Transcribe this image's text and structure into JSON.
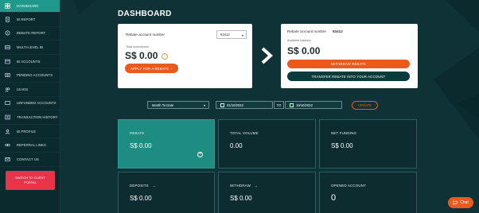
{
  "sidebar": {
    "items": [
      {
        "label": "DASHBOARD",
        "icon": "dashboard-icon",
        "active": true
      },
      {
        "label": "IB REPORT",
        "icon": "report-icon"
      },
      {
        "label": "REBATE REPORT",
        "icon": "rebate-icon"
      },
      {
        "label": "MULTI-LEVEL IB",
        "icon": "network-icon"
      },
      {
        "label": "IB ACCOUNTS",
        "icon": "accounts-icon"
      },
      {
        "label": "PENDING ACCOUNTS",
        "icon": "pending-icon"
      },
      {
        "label": "LEADS",
        "icon": "leads-icon"
      },
      {
        "label": "UNFUNDED ACCOUNTS",
        "icon": "unfunded-icon"
      },
      {
        "label": "TRANSACTION HISTORY",
        "icon": "history-icon"
      },
      {
        "label": "IB PROFILE",
        "icon": "profile-icon"
      },
      {
        "label": "REFERRAL LINKS",
        "icon": "link-icon"
      },
      {
        "label": "CONTACT US",
        "icon": "contact-icon"
      }
    ],
    "switch_line1": "SWITCH TO CLIENT",
    "switch_line2": "PORTAL"
  },
  "page_title": "DASHBOARD",
  "rebate_card": {
    "account_label": "Rebate account number",
    "account_select": "63412",
    "commission_label": "Total commission",
    "commission_value": "S$ 0.00",
    "apply_button": "APPLY FOR A REBATE",
    "apply_arrow": "›"
  },
  "balance_card": {
    "account_label": "Rebate account number",
    "account_number": "63412",
    "balance_label": "Available balance",
    "balance_value": "S$ 0.00",
    "withdraw_button": "WITHDRAW REBATE",
    "transfer_button": "TRANSFER REBATE INTO YOUR ACCOUNT"
  },
  "filters": {
    "period": "Month To Date",
    "date_from": "01/10/2022",
    "to_label": "TO",
    "date_to": "19/10/2022",
    "update_button": "UPDATE"
  },
  "stats": [
    {
      "title": "REBATE",
      "value": "S$ 0.00",
      "has_plus": true,
      "highlight": true
    },
    {
      "title": "TOTAL VOLUME",
      "value": "0.00"
    },
    {
      "title": "NET FUNDING",
      "value": "S$ 0.00"
    },
    {
      "title": "DEPOSITS",
      "value": "S$ 0.00",
      "title_suffix": "→"
    },
    {
      "title": "WITHDRAW",
      "value": "S$ 0.00",
      "title_suffix": "→"
    },
    {
      "title": "OPENED ACCOUNT",
      "value": "0"
    }
  ],
  "chat_label": "Chat",
  "colors": {
    "accent_teal": "#1f9a8a",
    "accent_orange": "#e85a1e",
    "switch_red": "#e8344a",
    "background": "#0e3236"
  }
}
